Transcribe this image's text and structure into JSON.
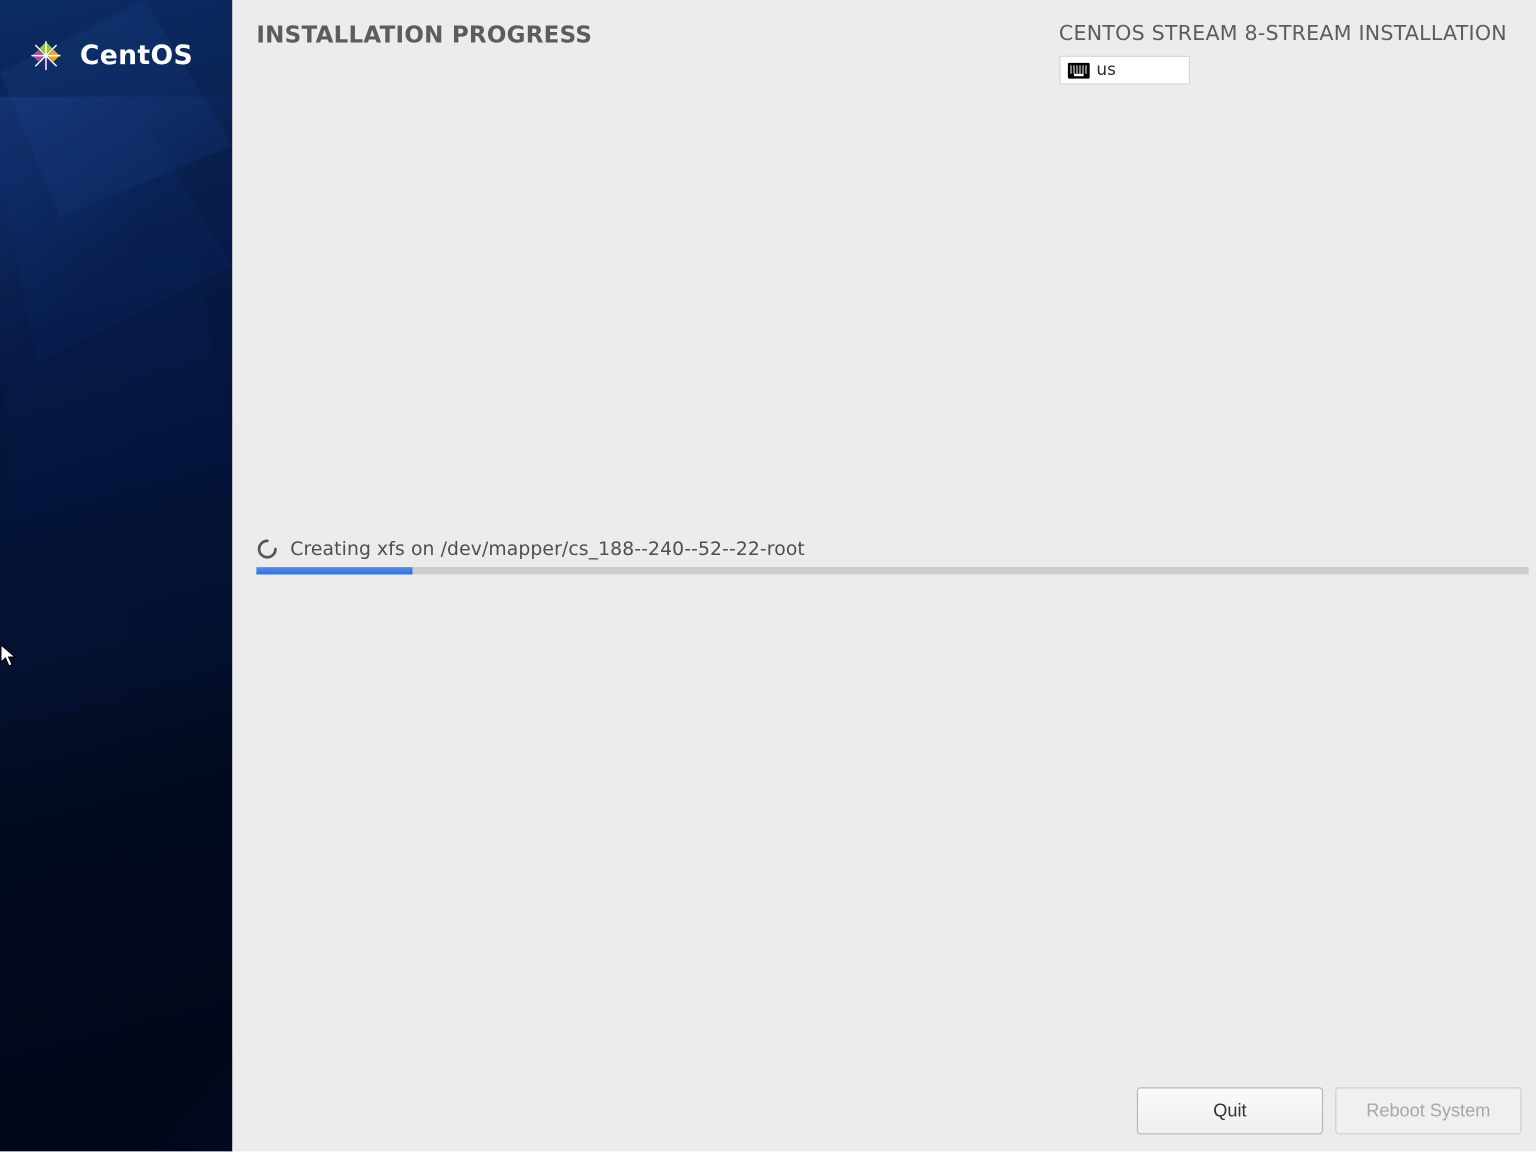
{
  "sidebar": {
    "brand": "CentOS"
  },
  "header": {
    "title": "INSTALLATION PROGRESS",
    "distribution": "CENTOS STREAM 8-STREAM INSTALLATION",
    "keyboard_layout": "us"
  },
  "progress": {
    "status_text": "Creating xfs on /dev/mapper/cs_188--240--52--22-root",
    "percent": 12.3
  },
  "footer": {
    "quit_label": "Quit",
    "reboot_label": "Reboot System"
  }
}
